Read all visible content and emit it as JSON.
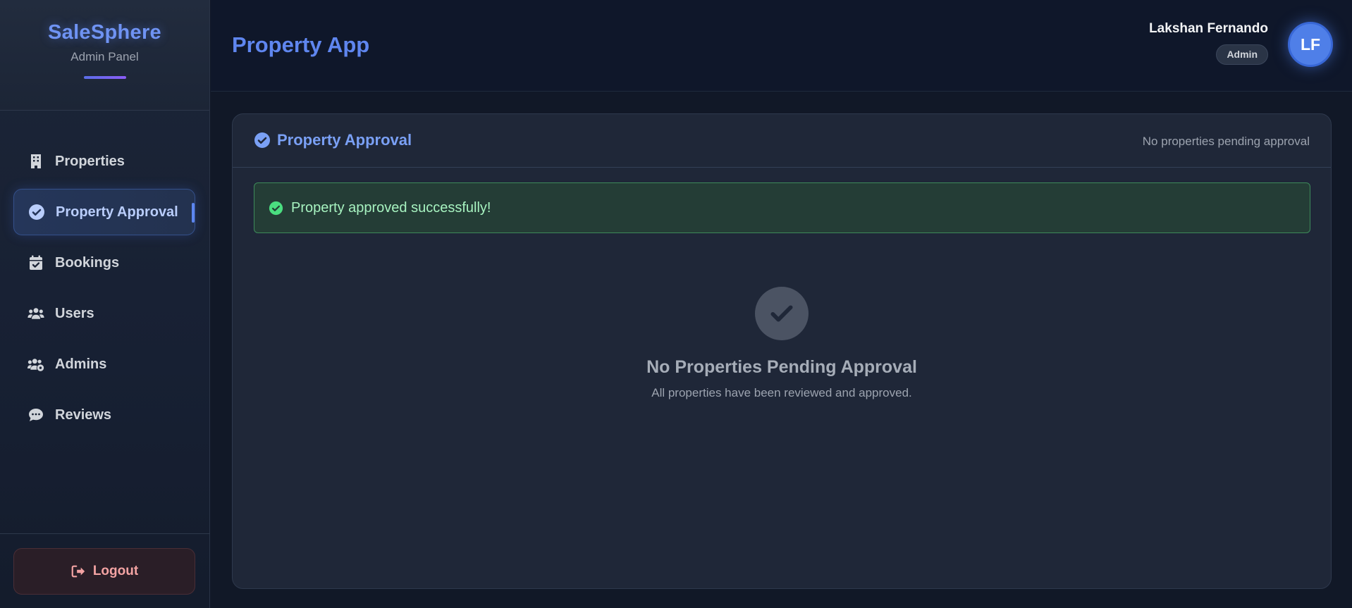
{
  "brand": {
    "title": "SaleSphere",
    "subtitle": "Admin Panel"
  },
  "sidebar": {
    "items": [
      {
        "label": "Properties",
        "icon": "building-icon",
        "active": false
      },
      {
        "label": "Property Approval",
        "icon": "check-circle-icon",
        "active": true
      },
      {
        "label": "Bookings",
        "icon": "calendar-check-icon",
        "active": false
      },
      {
        "label": "Users",
        "icon": "users-icon",
        "active": false
      },
      {
        "label": "Admins",
        "icon": "users-gear-icon",
        "active": false
      },
      {
        "label": "Reviews",
        "icon": "comments-icon",
        "active": false
      }
    ],
    "logout_label": "Logout"
  },
  "header": {
    "title": "Property App",
    "user_name": "Lakshan Fernando",
    "role": "Admin",
    "avatar_initials": "LF"
  },
  "card": {
    "title": "Property Approval",
    "status": "No properties pending approval",
    "alert": "Property approved successfully!",
    "empty_title": "No Properties Pending Approval",
    "empty_subtitle": "All properties have been reviewed and approved."
  },
  "colors": {
    "accent": "#5f86ef",
    "success": "#4ade80",
    "danger": "#f3a3a3",
    "background": "#111827"
  }
}
